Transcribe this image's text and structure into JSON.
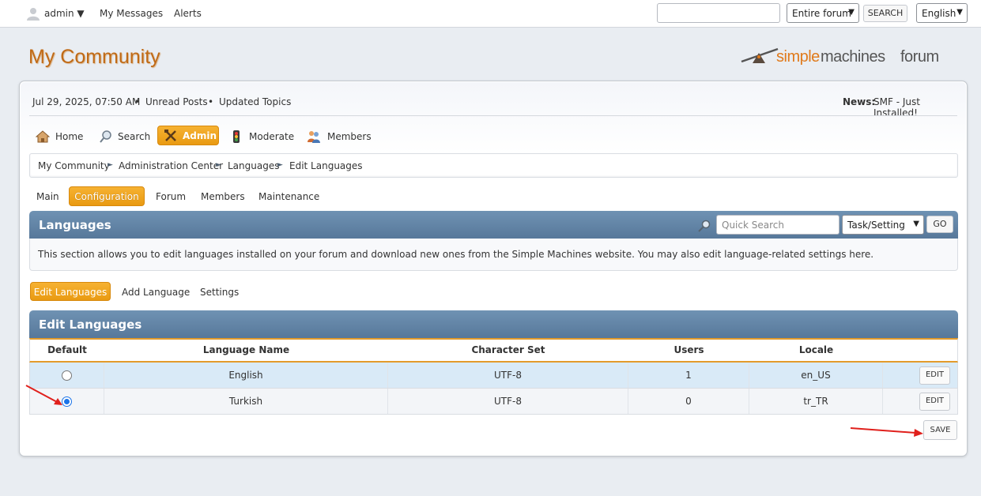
{
  "topbar": {
    "user": "admin ▼",
    "my_messages": "My Messages",
    "alerts": "Alerts",
    "search_scope": "Entire forum",
    "search_button": "SEARCH",
    "language": "English"
  },
  "header": {
    "site_title": "My Community",
    "logo_simple": "simple",
    "logo_machines": "machines",
    "logo_forum": "forum"
  },
  "info": {
    "datetime": "Jul 29, 2025, 07:50 AM",
    "bullet": "•",
    "unread_posts": "Unread Posts",
    "updated_topics": "Updated Topics",
    "news_label": "News:",
    "news_text": "SMF - Just Installed!"
  },
  "menu": {
    "home": "Home",
    "search": "Search",
    "admin": "Admin",
    "moderate": "Moderate",
    "members": "Members"
  },
  "breadcrumb": [
    "My Community",
    "Administration Center",
    "Languages",
    "Edit Languages"
  ],
  "tabs": [
    "Main",
    "Configuration",
    "Forum",
    "Members",
    "Maintenance"
  ],
  "languages_section": {
    "title": "Languages",
    "quick_search_placeholder": "Quick Search",
    "task_select": "Task/Setting",
    "go_button": "GO",
    "description": "This section allows you to edit languages installed on your forum and download new ones from the Simple Machines website. You may also edit language-related settings here."
  },
  "subtabs": [
    "Edit Languages",
    "Add Language",
    "Settings"
  ],
  "edit_languages": {
    "title": "Edit Languages",
    "columns": [
      "Default",
      "Language Name",
      "Character Set",
      "Users",
      "Locale"
    ],
    "rows": [
      {
        "name": "English",
        "charset": "UTF-8",
        "users": "1",
        "locale": "en_US",
        "default": false,
        "edit": "EDIT"
      },
      {
        "name": "Turkish",
        "charset": "UTF-8",
        "users": "0",
        "locale": "tr_TR",
        "default": true,
        "edit": "EDIT"
      }
    ],
    "save_button": "SAVE"
  },
  "colors": {
    "accent": "#e99a12",
    "catbar": "#5f80a2",
    "title": "#c06a16",
    "annotation_arrow": "#e0201c"
  }
}
